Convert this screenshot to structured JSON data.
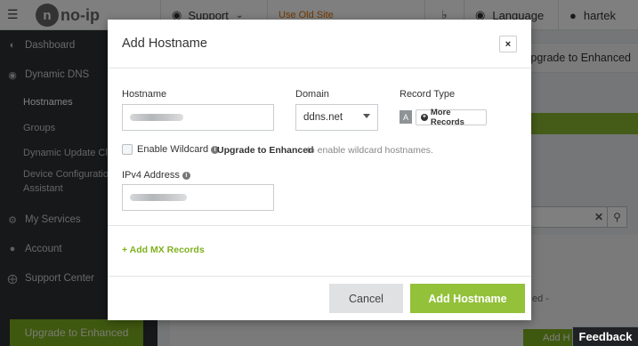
{
  "topbar": {
    "logo_text": "no-ip",
    "support_label": "Support",
    "old_site_label": "Use Old Site",
    "language_label": "Language",
    "user_label": "hartek",
    "upgrade_label": "Upgrade to Enhanced"
  },
  "sidebar": {
    "items": [
      {
        "label": "Dashboard",
        "icon": "dashboard-icon"
      },
      {
        "label": "Dynamic DNS",
        "icon": "globe-icon"
      },
      {
        "label": "Hostnames"
      },
      {
        "label": "Groups"
      },
      {
        "label": "Dynamic Update Cli"
      },
      {
        "label": "Device Configuration"
      },
      {
        "label": "Assistant"
      },
      {
        "label": "My Services",
        "icon": "gear-icon"
      },
      {
        "label": "Account",
        "icon": "user-icon"
      },
      {
        "label": "Support Center",
        "icon": "lifebuoy-icon"
      }
    ],
    "upgrade_button": "Upgrade to Enhanced"
  },
  "background": {
    "dash_text": "ed -",
    "add_button_partial": "Add H"
  },
  "modal": {
    "title": "Add Hostname",
    "close_label": "×",
    "hostname_label": "Hostname",
    "domain_label": "Domain",
    "domain_value": "ddns.net",
    "record_type_label": "Record Type",
    "record_type_value": "A",
    "more_records_label": "More Records",
    "wildcard_label": "Enable Wildcard",
    "upgrade_link": "Upgrade to Enhanced",
    "upgrade_rest": "to enable wildcard hostnames.",
    "ipv4_label": "IPv4 Address",
    "add_mx_label": "Add MX Records",
    "cancel_label": "Cancel",
    "submit_label": "Add Hostname"
  },
  "feedback_label": "Feedback",
  "colors": {
    "accent_green": "#93c13a",
    "sidebar_bg": "#2e3133",
    "old_site_orange": "#e67300"
  }
}
